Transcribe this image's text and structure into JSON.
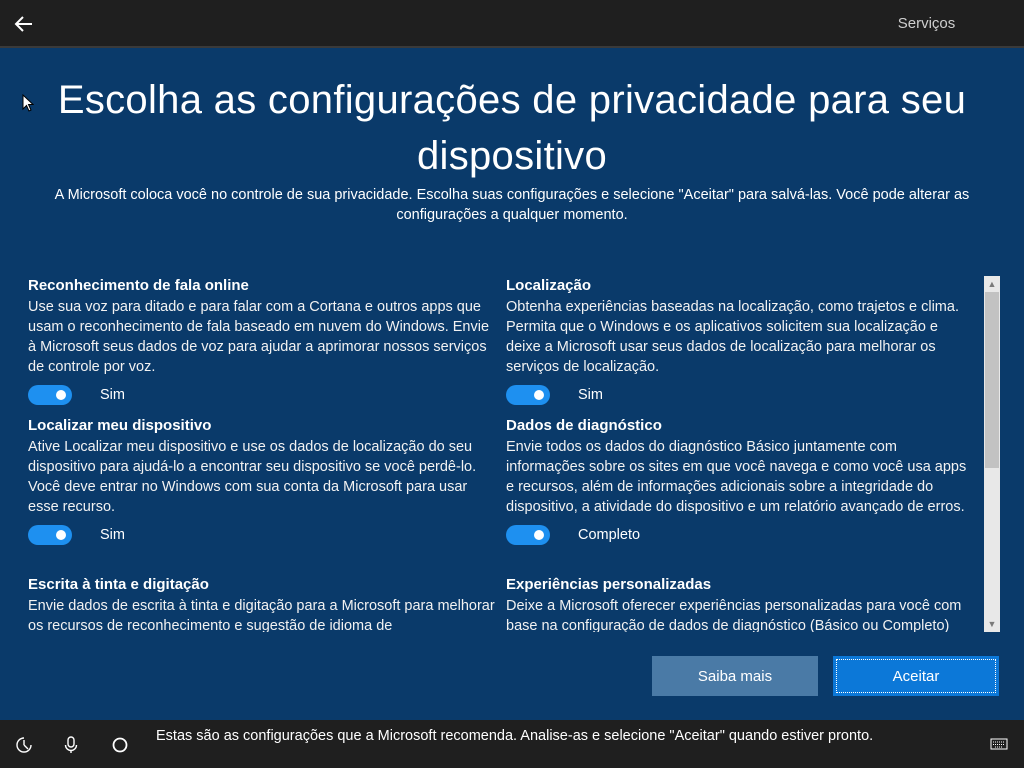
{
  "header": {
    "tab_label": "Serviços"
  },
  "page": {
    "title": "Escolha as configurações de privacidade para seu dispositivo",
    "subtitle": "A Microsoft coloca você no controle de sua privacidade. Escolha suas configurações e selecione \"Aceitar\" para salvá-las. Você pode alterar as configurações a qualquer momento."
  },
  "settings": {
    "left": [
      {
        "title": "Reconhecimento de fala online",
        "description": "Use sua voz para ditado e para falar com a Cortana e outros apps que usam o reconhecimento de fala baseado em nuvem do Windows. Envie à Microsoft seus dados de voz para ajudar a aprimorar nossos serviços de controle por voz.",
        "toggle_on": true,
        "toggle_label": "Sim"
      },
      {
        "title": "Localizar meu dispositivo",
        "description": "Ative Localizar meu dispositivo e use os dados de localização do seu dispositivo para ajudá-lo a encontrar seu dispositivo se você perdê-lo. Você deve entrar no Windows com sua conta da Microsoft para usar esse recurso.",
        "toggle_on": true,
        "toggle_label": "Sim"
      },
      {
        "title": "Escrita à tinta e digitação",
        "description": "Envie dados de escrita à tinta e digitação para a Microsoft para melhorar os recursos de reconhecimento e sugestão de idioma de"
      }
    ],
    "right": [
      {
        "title": "Localização",
        "description": "Obtenha experiências baseadas na localização, como trajetos e clima. Permita que o Windows e os aplicativos solicitem sua localização e deixe a Microsoft usar seus dados de localização para melhorar os serviços de localização.",
        "toggle_on": true,
        "toggle_label": "Sim"
      },
      {
        "title": "Dados de diagnóstico",
        "description": "Envie todos os dados do diagnóstico Básico juntamente com informações sobre os sites em que você navega e como você usa apps e recursos, além de informações adicionais sobre a integridade do dispositivo, a atividade do dispositivo e um relatório avançado de erros.",
        "toggle_on": true,
        "toggle_label": "Completo"
      },
      {
        "title": "Experiências personalizadas",
        "description": "Deixe a Microsoft oferecer experiências personalizadas para você com base na configuração de dados de diagnóstico (Básico ou Completo)"
      }
    ]
  },
  "buttons": {
    "learn_more": "Saiba mais",
    "accept": "Aceitar"
  },
  "taskbar": {
    "message": "Estas são as configurações que a Microsoft recomenda. Analise-as e selecione \"Aceitar\" quando estiver pronto.",
    "icons": [
      "accessibility-icon",
      "microphone-icon",
      "cortana-icon",
      "keyboard-icon"
    ]
  },
  "colors": {
    "background": "#0a3a6a",
    "toggle_on": "#1e90f0",
    "accept_button": "#0c78d8",
    "learn_more_button": "#4a7aa6",
    "topbar": "#1f1f1f"
  }
}
